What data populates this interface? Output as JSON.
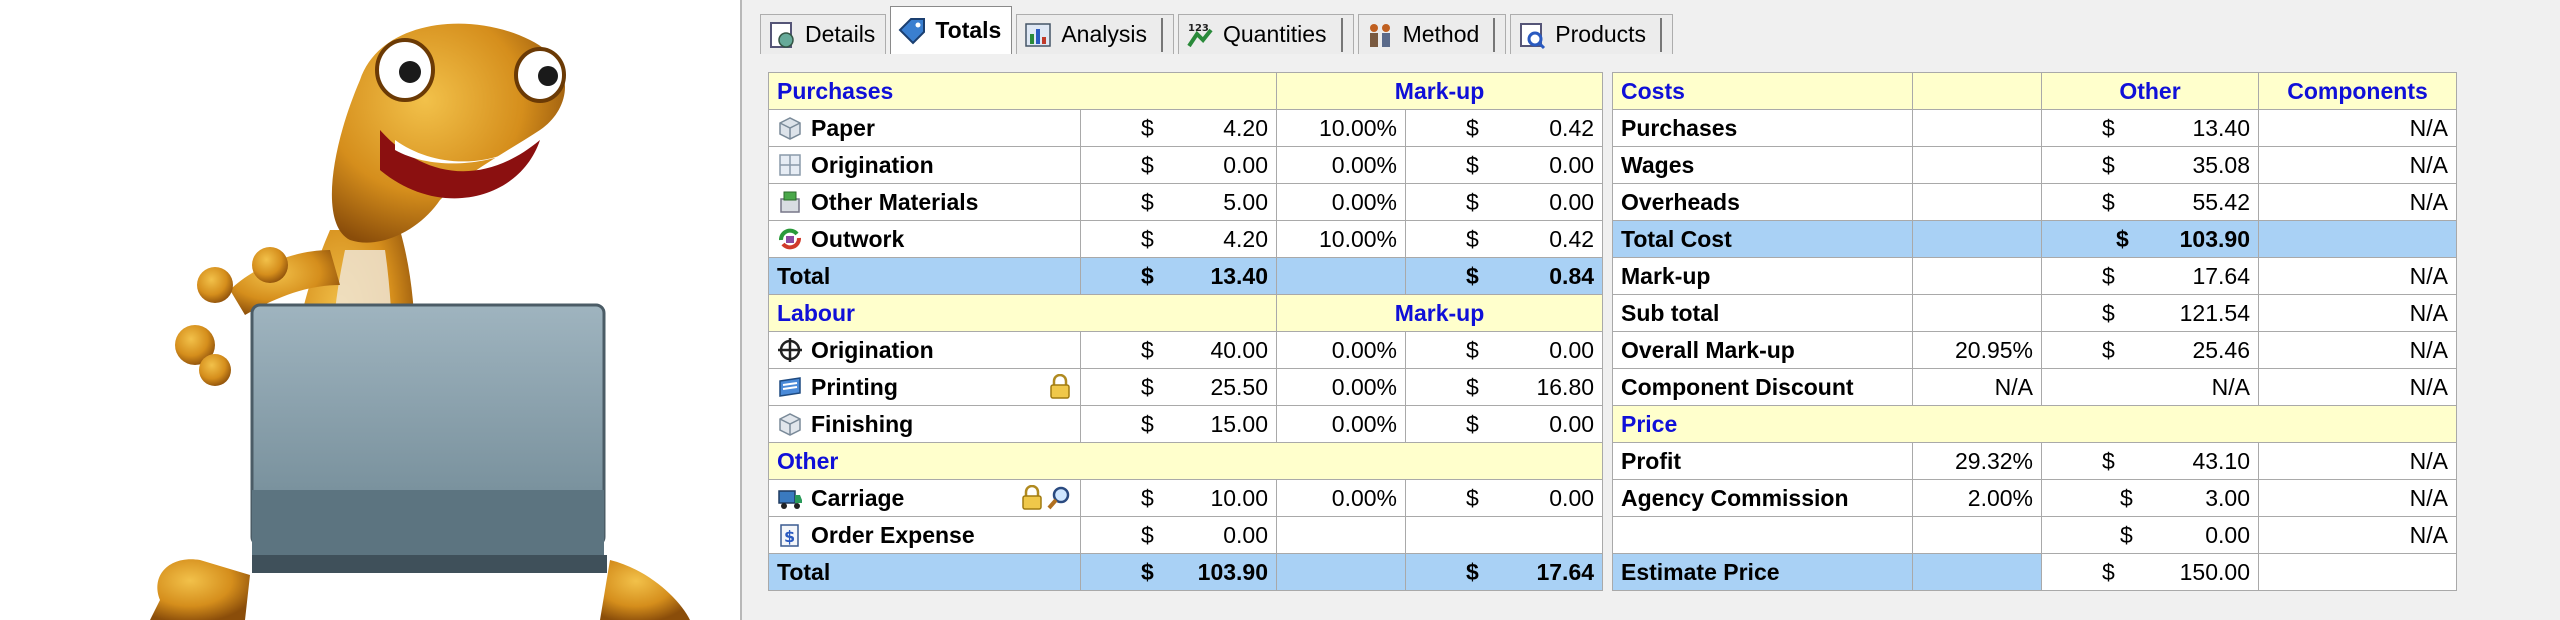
{
  "tabs": [
    {
      "label": "Details",
      "icon": "details-icon",
      "active": false
    },
    {
      "label": "Totals",
      "icon": "totals-icon",
      "active": true
    },
    {
      "label": "Analysis",
      "icon": "analysis-icon",
      "active": false
    },
    {
      "label": "Quantities",
      "icon": "quantities-icon",
      "active": false
    },
    {
      "label": "Method",
      "icon": "method-icon",
      "active": false
    },
    {
      "label": "Products",
      "icon": "products-icon",
      "active": false
    }
  ],
  "left": {
    "purchases_header": "Purchases",
    "markup_header": "Mark-up",
    "purchases": [
      {
        "label": "Paper",
        "icon": "paper-icon",
        "cur": "$",
        "amount": "4.20",
        "pct": "10.00%",
        "mcur": "$",
        "markup": "0.42"
      },
      {
        "label": "Origination",
        "icon": "origination-icon",
        "cur": "$",
        "amount": "0.00",
        "pct": "0.00%",
        "mcur": "$",
        "markup": "0.00"
      },
      {
        "label": "Other Materials",
        "icon": "other-materials-icon",
        "cur": "$",
        "amount": "5.00",
        "pct": "0.00%",
        "mcur": "$",
        "markup": "0.00"
      },
      {
        "label": "Outwork",
        "icon": "outwork-icon",
        "cur": "$",
        "amount": "4.20",
        "pct": "10.00%",
        "mcur": "$",
        "markup": "0.42"
      }
    ],
    "purchases_total": {
      "label": "Total",
      "cur": "$",
      "amount": "13.40",
      "mcur": "$",
      "markup": "0.84"
    },
    "labour_header": "Labour",
    "labour_markup_header": "Mark-up",
    "labour": [
      {
        "label": "Origination",
        "icon": "crosshair-icon",
        "cur": "$",
        "amount": "40.00",
        "pct": "0.00%",
        "mcur": "$",
        "markup": "0.00"
      },
      {
        "label": "Printing",
        "icon": "printing-icon",
        "lock": true,
        "cur": "$",
        "amount": "25.50",
        "pct": "0.00%",
        "mcur": "$",
        "markup": "16.80"
      },
      {
        "label": "Finishing",
        "icon": "finishing-icon",
        "cur": "$",
        "amount": "15.00",
        "pct": "0.00%",
        "mcur": "$",
        "markup": "0.00"
      }
    ],
    "other_header": "Other",
    "other": {
      "carriage": {
        "label": "Carriage",
        "icon": "carriage-icon",
        "cur": "$",
        "amount": "10.00",
        "pct": "0.00%",
        "mcur": "$",
        "markup": "0.00"
      },
      "order_expense": {
        "label": "Order Expense",
        "icon": "order-expense-icon",
        "cur": "$",
        "amount": "0.00"
      }
    },
    "grand_total": {
      "label": "Total",
      "cur": "$",
      "amount": "103.90",
      "mcur": "$",
      "markup": "17.64"
    }
  },
  "right": {
    "costs_header": "Costs",
    "other_header": "Other",
    "components_header": "Components",
    "rows": {
      "purchases": {
        "label": "Purchases",
        "cur": "$",
        "value": "13.40",
        "components": "N/A"
      },
      "wages": {
        "label": "Wages",
        "cur": "$",
        "value": "35.08",
        "components": "N/A"
      },
      "overheads": {
        "label": "Overheads",
        "cur": "$",
        "value": "55.42",
        "components": "N/A"
      },
      "total_cost": {
        "label": "Total Cost",
        "cur": "$",
        "value": "103.90"
      },
      "markup": {
        "label": "Mark-up",
        "cur": "$",
        "value": "17.64",
        "components": "N/A"
      },
      "sub_total": {
        "label": "Sub total",
        "cur": "$",
        "value": "121.54",
        "components": "N/A"
      },
      "overall_markup": {
        "label": "Overall Mark-up",
        "pct": "20.95%",
        "cur": "$",
        "value": "25.46",
        "components": "N/A"
      },
      "component_discount": {
        "label": "Component Discount",
        "pct": "N/A",
        "value": "N/A",
        "components": "N/A"
      },
      "profit": {
        "label": "Profit",
        "pct": "29.32%",
        "cur": "$",
        "value": "43.10",
        "components": "N/A"
      },
      "agency_commission": {
        "label": "Agency Commission",
        "pct": "2.00%",
        "cur": "$",
        "value": "3.00",
        "components": "N/A"
      },
      "blank": {
        "cur": "$",
        "value": "0.00",
        "components": "N/A"
      },
      "estimate_price": {
        "label": "Estimate Price",
        "cur": "$",
        "value": "150.00"
      }
    },
    "price_header": "Price"
  },
  "colors": {
    "header_bg": "#ffffcc",
    "header_text": "#1010d8",
    "total_bg": "#a9d1f5"
  }
}
